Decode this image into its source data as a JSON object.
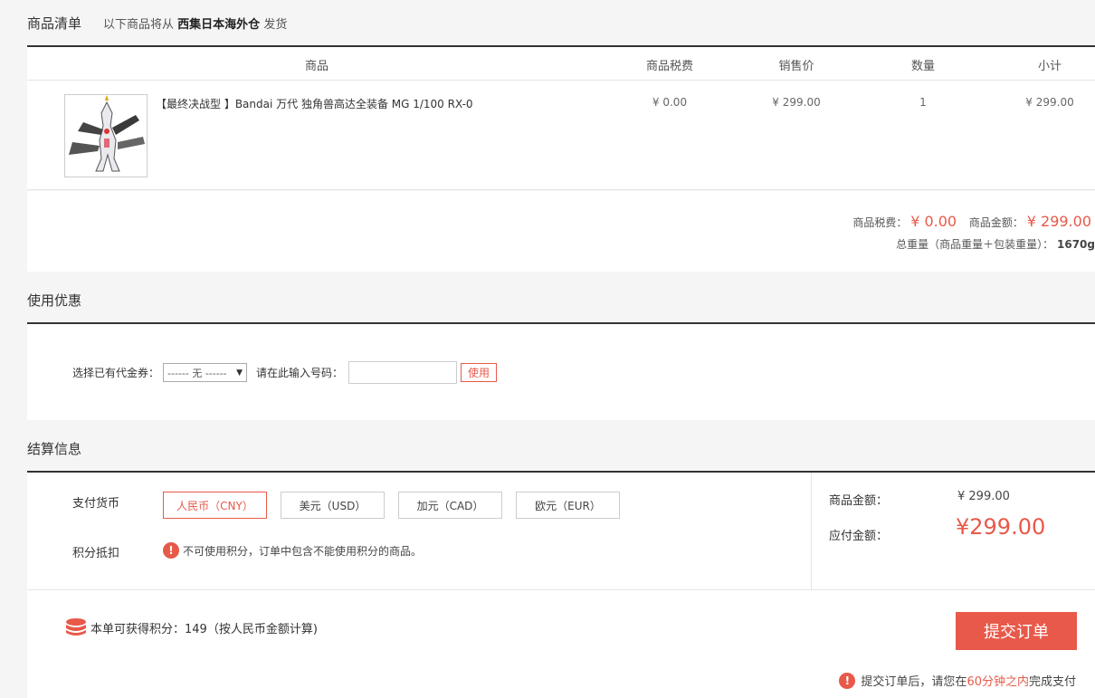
{
  "goods": {
    "title": "商品清单",
    "ship_prefix": "以下商品将从",
    "warehouse": "西集日本海外仓",
    "ship_suffix": "发货",
    "columns": {
      "product": "商品",
      "tax": "商品税费",
      "price": "销售价",
      "qty": "数量",
      "subtotal": "小计"
    },
    "items": [
      {
        "name": "【最终决战型 】Bandai 万代 独角兽高达全装备 MG 1/100 RX-0",
        "tax": "¥ 0.00",
        "price": "¥ 299.00",
        "qty": "1",
        "subtotal": "¥ 299.00"
      }
    ],
    "summary": {
      "tax_label": "商品税费：",
      "tax_value": "¥ 0.00",
      "amount_label": "商品金额：",
      "amount_value": "¥ 299.00",
      "weight_label": "总重量（商品重量＋包装重量）：",
      "weight_value": "1670g"
    }
  },
  "coupon": {
    "title": "使用优惠",
    "select_label": "选择已有代金券：",
    "select_value": "------ 无 ------",
    "code_label": "请在此输入号码：",
    "code_value": "",
    "use_button": "使用"
  },
  "settle": {
    "title": "结算信息",
    "currency_label": "支付货币",
    "currencies": [
      {
        "label": "人民币（CNY）",
        "active": true
      },
      {
        "label": "美元（USD）",
        "active": false
      },
      {
        "label": "加元（CAD）",
        "active": false
      },
      {
        "label": "欧元（EUR）",
        "active": false
      }
    ],
    "points_label": "积分抵扣",
    "points_msg": "不可使用积分，订单中包含不能使用积分的商品。",
    "goods_amount_label": "商品金额：",
    "goods_amount_value": "¥ 299.00",
    "payable_label": "应付金额：",
    "payable_value": "¥299.00"
  },
  "footer": {
    "earn_text": "本单可获得积分：149（按人民币金额计算)",
    "submit_button": "提交订单",
    "tip_prefix": "提交订单后，请您在",
    "tip_highlight": "60分钟之内",
    "tip_suffix": "完成支付"
  },
  "colors": {
    "accent": "#e8594a"
  }
}
